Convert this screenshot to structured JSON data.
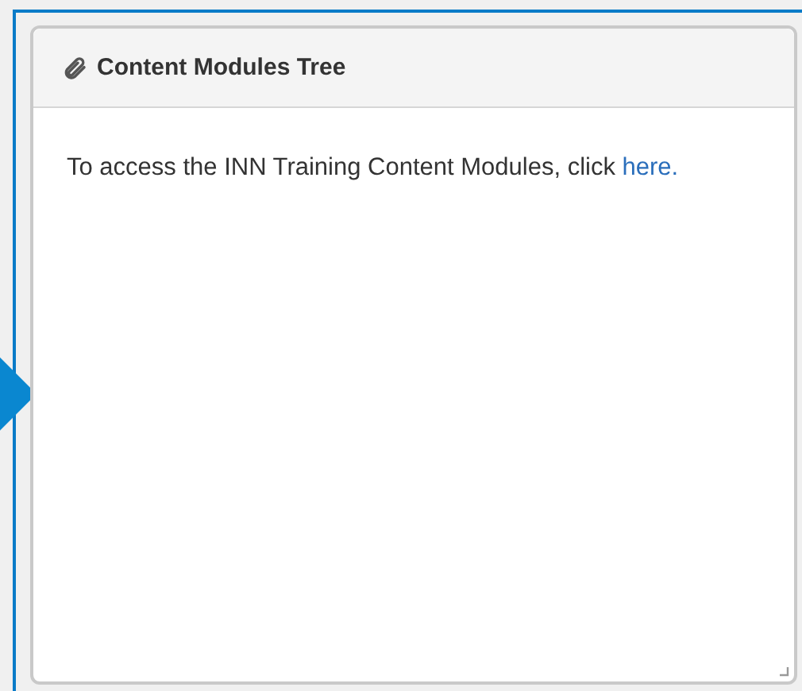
{
  "panel": {
    "title": "Content Modules Tree",
    "text": "To access the INN Training Content Modules, click",
    "link": "here."
  }
}
